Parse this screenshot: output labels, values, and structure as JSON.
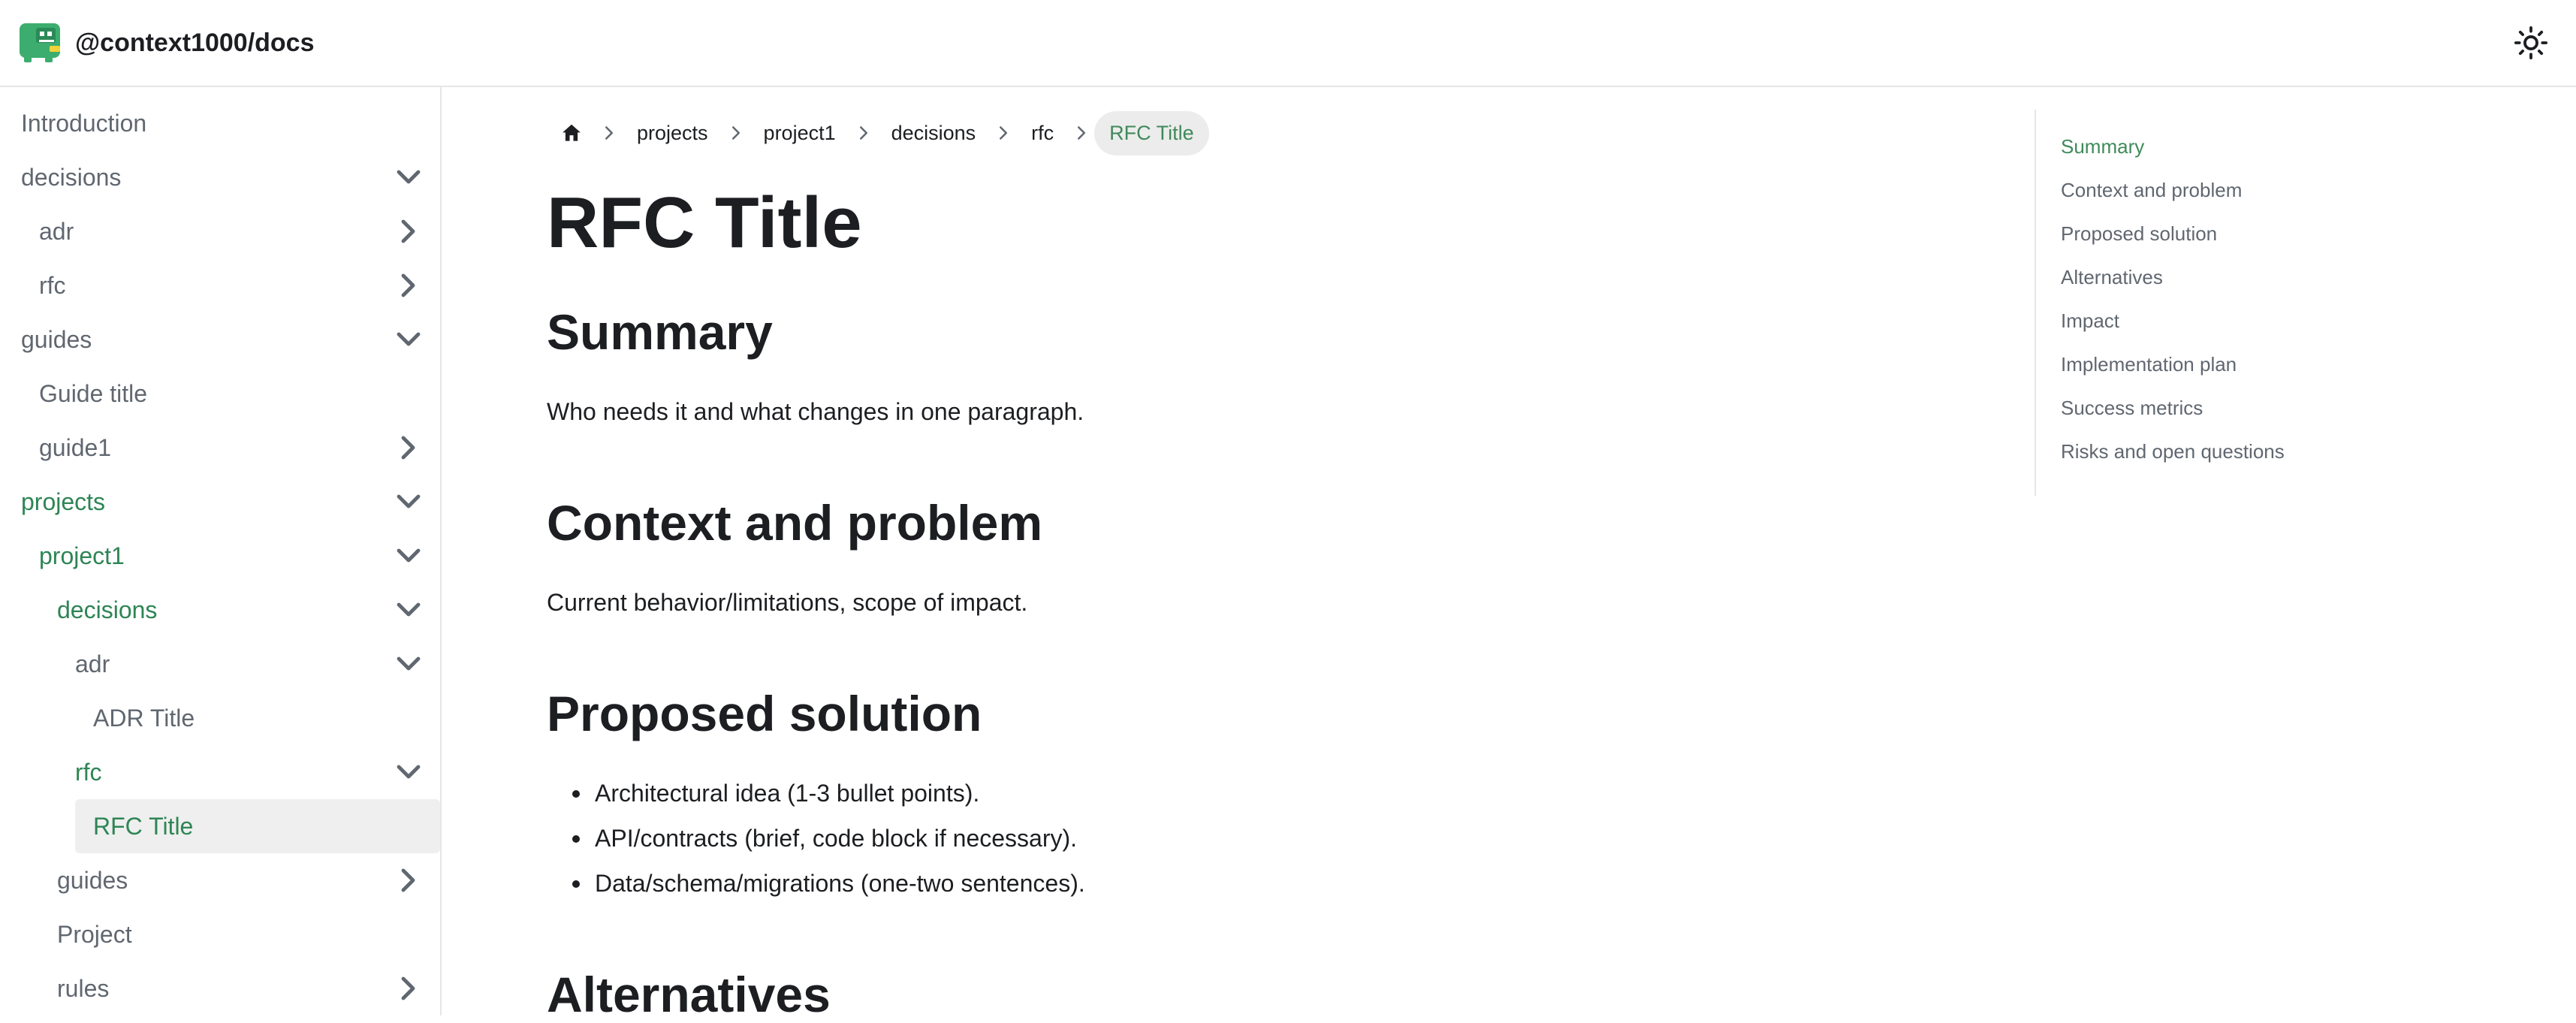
{
  "navbar": {
    "brand_title": "@context1000/docs",
    "logo_icon": "dino-logo-icon",
    "theme_toggle_icon": "sun-icon"
  },
  "sidebar": {
    "items": [
      {
        "label": "Introduction",
        "level": 0,
        "caret": "none",
        "state": "normal"
      },
      {
        "label": "decisions",
        "level": 0,
        "caret": "down",
        "state": "normal"
      },
      {
        "label": "adr",
        "level": 1,
        "caret": "right",
        "state": "normal"
      },
      {
        "label": "rfc",
        "level": 1,
        "caret": "right",
        "state": "normal"
      },
      {
        "label": "guides",
        "level": 0,
        "caret": "down",
        "state": "normal"
      },
      {
        "label": "Guide title",
        "level": 1,
        "caret": "none",
        "state": "normal"
      },
      {
        "label": "guide1",
        "level": 1,
        "caret": "right",
        "state": "normal"
      },
      {
        "label": "projects",
        "level": 0,
        "caret": "down",
        "state": "active"
      },
      {
        "label": "project1",
        "level": 1,
        "caret": "down",
        "state": "active"
      },
      {
        "label": "decisions",
        "level": 2,
        "caret": "down",
        "state": "active"
      },
      {
        "label": "adr",
        "level": 3,
        "caret": "down",
        "state": "normal"
      },
      {
        "label": "ADR Title",
        "level": 4,
        "caret": "none",
        "state": "normal"
      },
      {
        "label": "rfc",
        "level": 3,
        "caret": "down",
        "state": "active"
      },
      {
        "label": "RFC Title",
        "level": 4,
        "caret": "none",
        "state": "selected"
      },
      {
        "label": "guides",
        "level": 2,
        "caret": "right",
        "state": "normal"
      },
      {
        "label": "Project",
        "level": 2,
        "caret": "none",
        "state": "normal"
      },
      {
        "label": "rules",
        "level": 2,
        "caret": "right",
        "state": "normal"
      }
    ]
  },
  "breadcrumbs": {
    "home_icon": "home-icon",
    "items": [
      "projects",
      "project1",
      "decisions",
      "rfc",
      "RFC Title"
    ]
  },
  "doc": {
    "title": "RFC Title",
    "summary_heading": "Summary",
    "summary_text": "Who needs it and what changes in one paragraph.",
    "context_heading": "Context and problem",
    "context_text": "Current behavior/limitations, scope of impact.",
    "solution_heading": "Proposed solution",
    "solution_bullets": [
      "Architectural idea (1-3 bullet points).",
      "API/contracts (brief, code block if necessary).",
      "Data/schema/migrations (one-two sentences)."
    ],
    "alternatives_heading": "Alternatives"
  },
  "toc": {
    "items": [
      {
        "label": "Summary",
        "active": true
      },
      {
        "label": "Context and problem",
        "active": false
      },
      {
        "label": "Proposed solution",
        "active": false
      },
      {
        "label": "Alternatives",
        "active": false
      },
      {
        "label": "Impact",
        "active": false
      },
      {
        "label": "Implementation plan",
        "active": false
      },
      {
        "label": "Success metrics",
        "active": false
      },
      {
        "label": "Risks and open questions",
        "active": false
      }
    ]
  },
  "colors": {
    "accent": "#2e8555",
    "text": "#1c1e21",
    "muted": "#606770",
    "border": "#e6e6e6"
  }
}
